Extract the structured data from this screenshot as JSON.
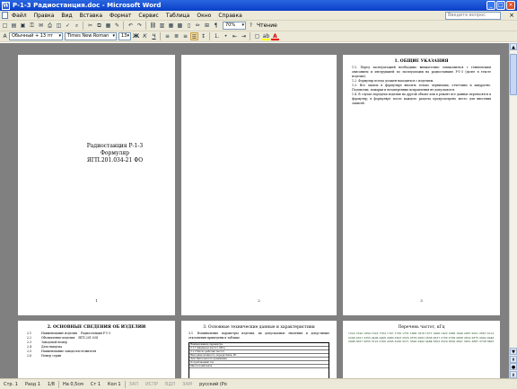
{
  "window": {
    "title": "Р-1-3 Радиостанция.doc - Microsoft Word",
    "minimize": "_",
    "maximize": "□",
    "close": "×"
  },
  "menu": {
    "items": [
      "Файл",
      "Правка",
      "Вид",
      "Вставка",
      "Формат",
      "Сервис",
      "Таблица",
      "Окно",
      "Справка"
    ],
    "help_placeholder": "Введите вопрос",
    "doc_close": "×"
  },
  "toolbar_standard": {
    "icons": [
      "new-icon",
      "open-icon",
      "save-icon",
      "permission-icon",
      "email-icon",
      "print-icon",
      "preview-icon",
      "spelling-icon",
      "research-icon",
      "cut-icon",
      "copy-icon",
      "paste-icon",
      "format-painter-icon",
      "undo-icon",
      "redo-icon",
      "hyperlink-icon",
      "tables-icon",
      "insert-table-icon",
      "excel-icon",
      "columns-icon",
      "drawing-icon",
      "docmap-icon",
      "showhide-icon"
    ],
    "glyphs": [
      "□",
      "▤",
      "▣",
      "⚿",
      "✉",
      "⎙",
      "◫",
      "✓",
      "⌕",
      "✂",
      "⧉",
      "▦",
      "✎",
      "↶",
      "↷",
      "⛓",
      "▥",
      "▦",
      "▩",
      "▯",
      "✏",
      "⊞",
      "¶"
    ],
    "zoom": "70%",
    "read_label": "Чтение"
  },
  "toolbar_formatting": {
    "style": "Обычный + 13 пт",
    "font": "Times New Roman",
    "size": "13",
    "bold": "Ж",
    "italic": "К",
    "underline": "Ч",
    "align_icons": [
      "align-left-icon",
      "align-center-icon",
      "align-right-icon",
      "justify-icon"
    ],
    "align_glyphs": [
      "≡",
      "≣",
      "≡",
      "☰"
    ],
    "list_icons": [
      "line-spacing-icon",
      "numbering-icon",
      "bullets-icon",
      "decrease-indent-icon",
      "increase-indent-icon"
    ],
    "list_glyphs": [
      "↕",
      "⒈",
      "•",
      "⇤",
      "⇥"
    ],
    "color_icons": [
      "border-icon",
      "highlight-icon",
      "font-color-icon"
    ],
    "color_glyphs": [
      "▢",
      "ab",
      "A"
    ]
  },
  "pages": {
    "p1": {
      "title_lines": [
        "Радиостанция Р-1-3",
        "Формуляр",
        "ЯГП.201.034-21 ФО"
      ],
      "page_number": "1"
    },
    "p2": {
      "page_number": "2"
    },
    "p3": {
      "heading": "1. ОБЩИЕ УКАЗАНИЯ",
      "paragraphs": [
        "1.1. Перед эксплуатацией необходимо внимательно ознакомиться с техническим описанием и инструкцией по эксплуатации на радиостанцию Р-1-3 (далее в тексте изделие).",
        "1.2. Формуляр всегда должен находиться с изделием.",
        "1.3. Все записи в формуляре вносить только чернилами, отчетливо и аккуратно. Подчистки, помарки и незаверенные исправления не допускаются.",
        "1.4. В случае передачи изделия на другой объект или в ремонт все данные переносятся в формуляр; в формуляре после каждого раздела предусмотрено место для внесения записей."
      ],
      "page_number": "3"
    },
    "p4": {
      "heading": "2. ОСНОВНЫЕ СВЕДЕНИЯ ОБ ИЗДЕЛИИ",
      "rows": [
        [
          "2.1",
          "Наименование изделия",
          "Радиостанция Р-1-3"
        ],
        [
          "2.2",
          "Обозначение изделия",
          "ЯГП.201.034"
        ],
        [
          "2.3",
          "Заводской номер",
          ""
        ],
        [
          "2.4",
          "Дата выпуска",
          ""
        ],
        [
          "2.5",
          "Наименование завода-изготовителя",
          ""
        ],
        [
          "2.6",
          "Номер серии",
          ""
        ]
      ]
    },
    "p5": {
      "heading": "3. Основные технические данные и характеристики",
      "text": "3.1. Номинальные параметры изделия, их допускаемые значения и допустимые отклонения приведены в таблице.",
      "table_rows": [
        "Наименование параметра",
        "3.1.1 Диапазон частот, МГц",
        "3.1.2 Число рабочих частот",
        "Выходная мощность передатчика, Вт",
        "Чувствительность приемника",
        "Потребляемый ток",
        "Масса комплекта"
      ]
    },
    "p6": {
      "heading": "Перечень частот, кГц",
      "numbers": "1522 1520 1650 1523 1702 1747 1750 1751 1808 1816 1871 1906 1922 1966 1940 2007 2031 2067 2212 2290 2321 2355 2406 2408 2480 2503 2525 2579 2603 2636 2637 2705 2769 2808 2814 2875 2902 2948 2996 3027 3055 3122 3166 3205 3236 3271 3326 3402 3484 3503 3520 3550 3601 3631 3687 3738 3805"
    }
  },
  "statusbar": {
    "page": "Стр. 1",
    "section": "Разд 1",
    "pages": "1/8",
    "at": "На 0,5см",
    "line": "Ст 1",
    "col": "Кол 1",
    "rec": "ЗАП",
    "trk": "ИСПР",
    "ext": "ВДЛ",
    "ovr": "ЗАМ",
    "lang": "русский (Ро"
  }
}
